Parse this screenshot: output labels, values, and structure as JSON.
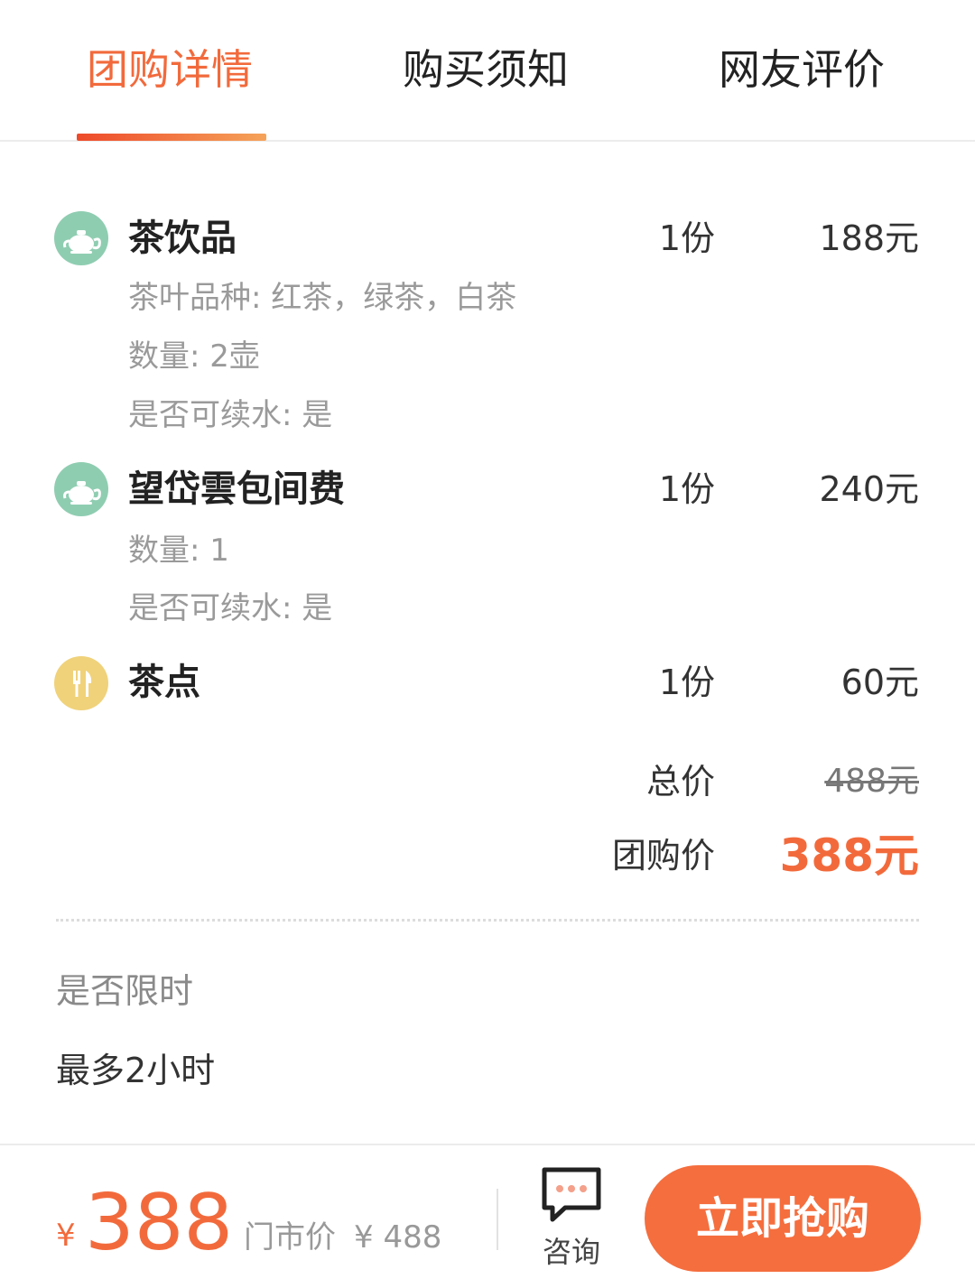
{
  "tabs": [
    {
      "label": "团购详情",
      "active": true
    },
    {
      "label": "购买须知",
      "active": false
    },
    {
      "label": "网友评价",
      "active": false
    }
  ],
  "items": [
    {
      "icon": "teapot-icon",
      "name": "茶饮品",
      "qty": "1份",
      "price": "188元",
      "details": [
        "茶叶品种: 红茶，绿茶，白茶",
        "数量: 2壶",
        "是否可续水: 是"
      ]
    },
    {
      "icon": "teapot-icon",
      "name": "望岱雲包间费",
      "qty": "1份",
      "price": "240元",
      "details": [
        "数量: 1",
        "是否可续水: 是"
      ]
    },
    {
      "icon": "cutlery-icon",
      "name": "茶点",
      "qty": "1份",
      "price": "60元",
      "details": []
    }
  ],
  "summary": {
    "total_label": "总价",
    "total_value": "488元",
    "group_label": "团购价",
    "group_value": "388元"
  },
  "time_limit": {
    "label": "是否限时",
    "value": "最多2小时"
  },
  "bottom_bar": {
    "currency": "¥",
    "price": "388",
    "market_label": "门市价",
    "market_price": "¥ 488",
    "consult_label": "咨询",
    "buy_label": "立即抢购"
  },
  "colors": {
    "accent": "#f26a3c",
    "teapot_icon_bg": "#8fcdb1",
    "cutlery_icon_bg": "#f0d27b",
    "muted_text": "#9a9a9a"
  }
}
